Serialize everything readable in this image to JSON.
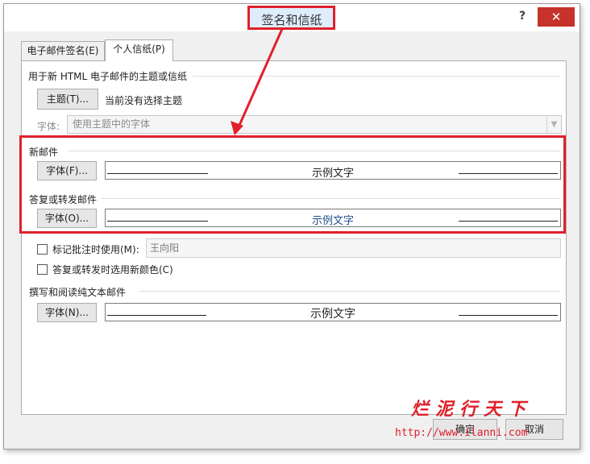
{
  "window": {
    "title": "签名和信纸",
    "help": "?",
    "close": "✕"
  },
  "tabs": [
    {
      "label": "电子邮件签名(E)",
      "active": false
    },
    {
      "label": "个人信纸(P)",
      "active": true
    }
  ],
  "theme_section": {
    "heading": "用于新 HTML 电子邮件的主题或信纸",
    "theme_button": "主题(T)...",
    "current_theme": "当前没有选择主题",
    "font_label": "字体:",
    "font_value": "使用主题中的字体"
  },
  "new_mail": {
    "heading": "新邮件",
    "font_button": "字体(F)...",
    "sample": "示例文字"
  },
  "reply_forward": {
    "heading": "答复或转发邮件",
    "font_button": "字体(O)...",
    "sample": "示例文字"
  },
  "comments": {
    "mark_label": "标记批注时使用(M):",
    "mark_value": "王向阳",
    "new_color_label": "答复或转发时选用新颜色(C)"
  },
  "plain_text": {
    "heading": "撰写和阅读纯文本邮件",
    "font_button": "字体(N)...",
    "sample": "示例文字"
  },
  "footer": {
    "ok": "确定",
    "cancel": "取消"
  },
  "watermark": {
    "text": "烂泥行天下",
    "url": "http://www.ilanni.com"
  },
  "colors": {
    "annotation_red": "#e0202a",
    "close_red": "#c7322a",
    "link_blue": "#1f4e8c"
  }
}
